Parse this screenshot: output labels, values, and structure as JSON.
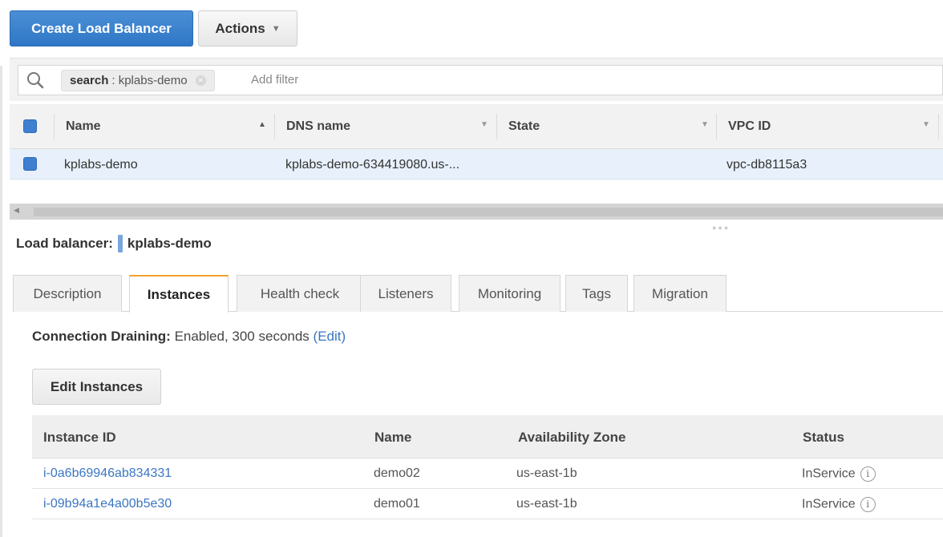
{
  "toolbar": {
    "create_label": "Create Load Balancer",
    "actions_label": "Actions"
  },
  "filter": {
    "token_key": "search",
    "token_value": ": kplabs-demo",
    "add_filter_placeholder": "Add filter"
  },
  "grid": {
    "columns": [
      "Name",
      "DNS name",
      "State",
      "VPC ID"
    ],
    "rows": [
      {
        "name": "kplabs-demo",
        "dns": "kplabs-demo-634419080.us-...",
        "state": "",
        "vpc": "vpc-db8115a3"
      }
    ]
  },
  "detail": {
    "title_prefix": "Load balancer:",
    "title_name": "kplabs-demo",
    "tabs": [
      "Description",
      "Instances",
      "Health check",
      "Listeners",
      "Monitoring",
      "Tags",
      "Migration"
    ],
    "active_tab": "Instances",
    "connection_draining_label": "Connection Draining:",
    "connection_draining_value": "Enabled, 300 seconds",
    "edit_link": "(Edit)",
    "edit_instances_label": "Edit Instances"
  },
  "instances": {
    "columns": [
      "Instance ID",
      "Name",
      "Availability Zone",
      "Status"
    ],
    "rows": [
      {
        "id": "i-0a6b69946ab834331",
        "name": "demo02",
        "zone": "us-east-1b",
        "status": "InService"
      },
      {
        "id": "i-09b94a1e4a00b5e30",
        "name": "demo01",
        "zone": "us-east-1b",
        "status": "InService"
      }
    ]
  },
  "colors": {
    "primary": "#2f77c6",
    "link": "#3a76c2",
    "active_tab_accent": "#f0a12a",
    "selected_row": "#e8f1fb"
  }
}
